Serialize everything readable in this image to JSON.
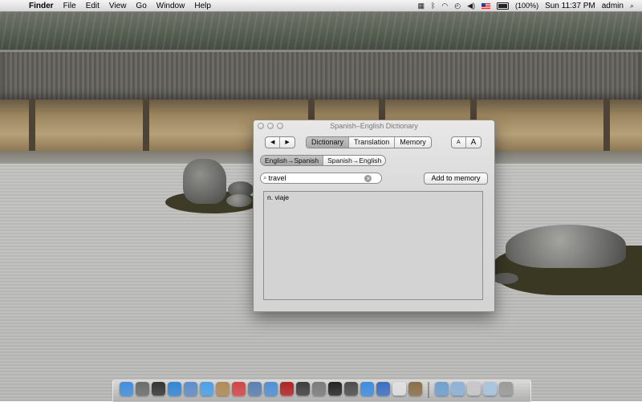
{
  "menubar": {
    "apple_glyph": "",
    "app_name": "Finder",
    "menus": [
      "File",
      "Edit",
      "View",
      "Go",
      "Window",
      "Help"
    ],
    "battery_text": "(100%)",
    "clock": "Sun 11:37 PM",
    "user": "admin",
    "search_glyph": "⌕"
  },
  "window": {
    "title": "Spanish–English Dictionary",
    "nav": {
      "back": "◀",
      "forward": "▶"
    },
    "mode_tabs": [
      {
        "label": "Dictionary",
        "selected": true
      },
      {
        "label": "Translation",
        "selected": false
      },
      {
        "label": "Memory",
        "selected": false
      }
    ],
    "font_size": {
      "small": "A",
      "large": "A"
    },
    "direction_tabs": [
      {
        "label": "English→Spanish",
        "selected": true
      },
      {
        "label": "Spanish→English",
        "selected": false
      }
    ],
    "search": {
      "value": "travel",
      "clear_glyph": "×"
    },
    "add_button": "Add to memory",
    "result": "n. viaje"
  },
  "dock": {
    "icons": [
      {
        "name": "finder-icon",
        "color": "#3f8ee0"
      },
      {
        "name": "rocket-icon",
        "color": "#6b6b6b"
      },
      {
        "name": "dashboard-icon",
        "color": "#333333"
      },
      {
        "name": "safari-icon",
        "color": "#2f86d8"
      },
      {
        "name": "mail-icon",
        "color": "#5d8cc9"
      },
      {
        "name": "ichat-icon",
        "color": "#4aa0e8"
      },
      {
        "name": "address-book-icon",
        "color": "#b08a55"
      },
      {
        "name": "ical-icon",
        "color": "#d44444"
      },
      {
        "name": "iphoto-icon",
        "color": "#5a7fb0"
      },
      {
        "name": "itunes-icon",
        "color": "#4f8fd6"
      },
      {
        "name": "photo-booth-icon",
        "color": "#b22222"
      },
      {
        "name": "time-machine-icon",
        "color": "#3d3d3d"
      },
      {
        "name": "system-preferences-icon",
        "color": "#7a7a7a"
      },
      {
        "name": "terminal-icon",
        "color": "#222222"
      },
      {
        "name": "activity-icon",
        "color": "#4c4c4c"
      },
      {
        "name": "network-icon",
        "color": "#3b8de0"
      },
      {
        "name": "xcode-icon",
        "color": "#3a6fc0"
      },
      {
        "name": "textedit-icon",
        "color": "#e0e0e0"
      },
      {
        "name": "dictionary-icon",
        "color": "#8a6f45"
      },
      {
        "name": "stack-apps-icon",
        "color": "#6fa0d0"
      },
      {
        "name": "stack-docs-icon",
        "color": "#8eb2d6"
      },
      {
        "name": "stack-downloads-icon",
        "color": "#c8c8c8"
      },
      {
        "name": "stack-pictures-icon",
        "color": "#a9c4de"
      },
      {
        "name": "trash-icon",
        "color": "#9a9a9a"
      }
    ]
  }
}
